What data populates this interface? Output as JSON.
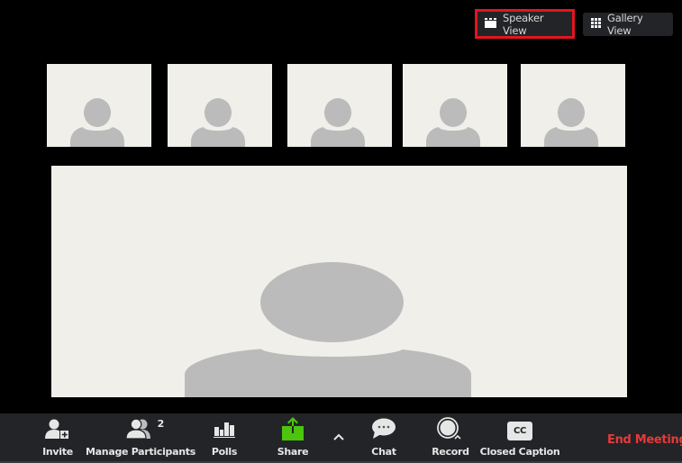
{
  "view_switcher": {
    "speaker_view_label": "Speaker View",
    "gallery_view_label": "Gallery View",
    "active": "speaker"
  },
  "thumbnails": [
    {
      "avatar": "default-avatar"
    },
    {
      "avatar": "default-avatar"
    },
    {
      "avatar": "default-avatar"
    },
    {
      "avatar": "default-avatar"
    },
    {
      "avatar": "default-avatar"
    }
  ],
  "main_video": {
    "avatar": "default-avatar"
  },
  "toolbar": {
    "invite_label": "Invite",
    "manage_participants_label": "Manage Participants",
    "participant_count": "2",
    "polls_label": "Polls",
    "share_label": "Share",
    "chat_label": "Chat",
    "record_label": "Record",
    "closed_caption_label": "Closed Caption",
    "cc_icon_text": "CC",
    "end_meeting_label": "End Meeting"
  },
  "colors": {
    "share_green": "#4cc50d",
    "end_meeting_red": "#e53a3a",
    "highlight_red": "#e5141f",
    "toolbar_bg": "#232427",
    "video_bg": "#f0efea",
    "avatar_gray": "#bbbbbb"
  }
}
